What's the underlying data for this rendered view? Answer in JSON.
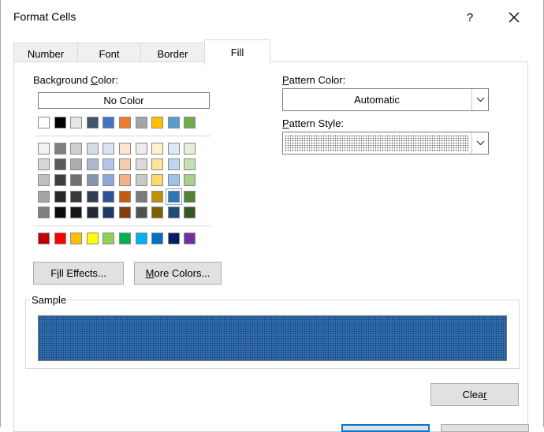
{
  "window": {
    "title": "Format Cells",
    "help_label": "?"
  },
  "tabs": [
    {
      "label": "Number"
    },
    {
      "label": "Font"
    },
    {
      "label": "Border"
    },
    {
      "label": "Fill",
      "active": true
    }
  ],
  "fill": {
    "background_color_label_pre": "Background ",
    "background_color_label_key": "C",
    "background_color_label_post": "olor:",
    "no_color_label": "No Color",
    "palette": {
      "row0": [
        "#ffffff",
        "#000000",
        "#e7e6e6",
        "#44546a",
        "#4472c4",
        "#ed7d31",
        "#a5a5a5",
        "#ffc000",
        "#5b9bd5",
        "#70ad47"
      ],
      "theme_rows": [
        [
          "#f2f2f2",
          "#7f7f7f",
          "#d0cece",
          "#d6dce4",
          "#d9e2f3",
          "#fbe5d5",
          "#ededed",
          "#fff2cc",
          "#deebf6",
          "#e2efd9"
        ],
        [
          "#d8d8d8",
          "#595959",
          "#aeabab",
          "#adb9ca",
          "#b4c6e7",
          "#f7cbac",
          "#dbdbdb",
          "#fee599",
          "#bdd7ee",
          "#c5e0b3"
        ],
        [
          "#bfbfbf",
          "#3f3f3f",
          "#757070",
          "#8496b0",
          "#8eaadb",
          "#f4b183",
          "#c9c9c9",
          "#ffd965",
          "#9dc3e6",
          "#a8d08d"
        ],
        [
          "#a5a5a5",
          "#262626",
          "#3a3838",
          "#333f4f",
          "#2f5496",
          "#c55a11",
          "#7b7b7b",
          "#bf9000",
          "#2e75b5",
          "#538135"
        ],
        [
          "#7f7f7f",
          "#0c0c0c",
          "#171616",
          "#222a35",
          "#1f3864",
          "#833c0b",
          "#525252",
          "#7f6000",
          "#1f4e79",
          "#375623"
        ]
      ],
      "standard_row": [
        "#c00000",
        "#ff0000",
        "#ffc000",
        "#ffff00",
        "#92d050",
        "#00b050",
        "#00b0f0",
        "#0070c0",
        "#002060",
        "#7030a0"
      ],
      "selected": {
        "row": 3,
        "col": 8
      }
    },
    "fill_effects_label_pre": "F",
    "fill_effects_label_key": "i",
    "fill_effects_label_post": "ll Effects...",
    "more_colors_label_key": "M",
    "more_colors_label_post": "ore Colors...",
    "pattern_color_label_key": "P",
    "pattern_color_label_post": "attern Color:",
    "pattern_color_value": "Automatic",
    "pattern_style_label_key": "P",
    "pattern_style_label_post": "attern Style:",
    "pattern_style_value": "dotted",
    "sample_label": "Sample",
    "sample_fill_color": "#2f6fb5",
    "clear_label_pre": "Clea",
    "clear_label_key": "r"
  }
}
